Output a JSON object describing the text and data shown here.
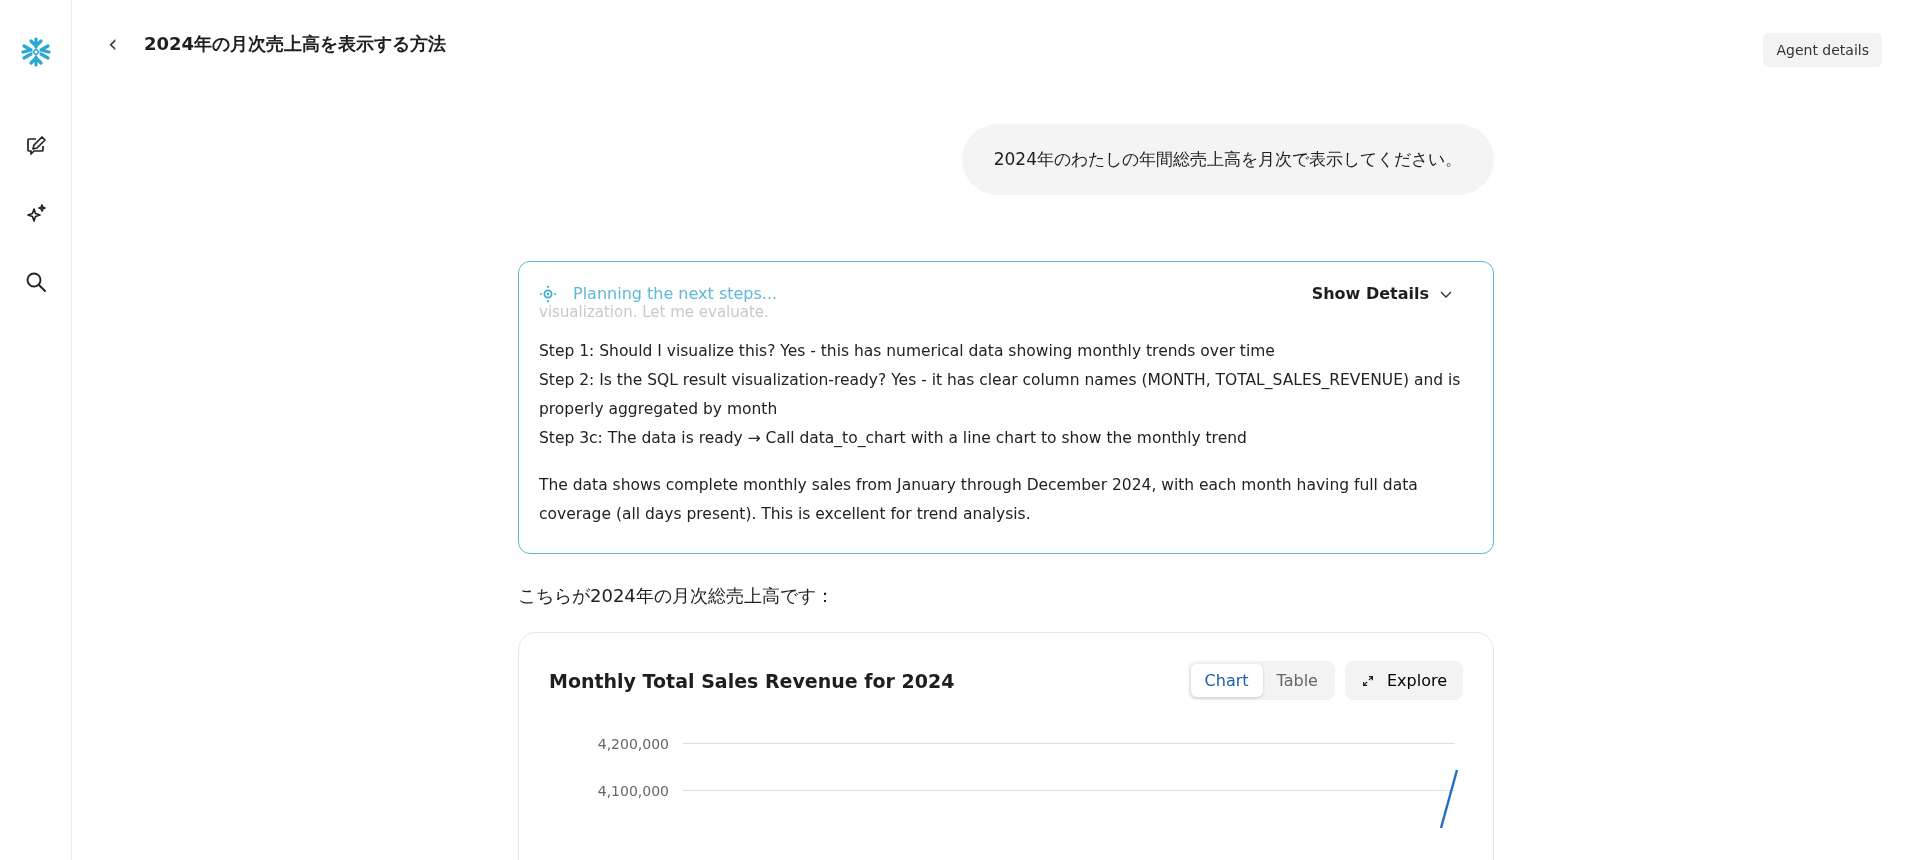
{
  "header": {
    "back": "‹",
    "title": "2024年の月次売上高を表示する方法",
    "agent_button": "Agent details"
  },
  "sidebar": {
    "items": [
      {
        "kind": "compose"
      },
      {
        "kind": "sparkle"
      },
      {
        "kind": "search"
      }
    ]
  },
  "user_message": "2024年のわたしの年間総売上高を月次で表示してください。",
  "planning": {
    "status": "Planning the next steps...",
    "toggle": "Show Details",
    "expanded": false,
    "faded_line": "visualization. Let me evaluate.",
    "paragraphs": [
      [
        "Step 1: Should I visualize this? Yes - this has numerical data showing monthly trends over time",
        "Step 2: Is the SQL result visualization-ready? Yes - it has clear column names (MONTH, TOTAL_SALES_REVENUE) and is properly aggregated by month",
        "Step 3c: The data is ready → Call data_to_chart with a line chart to show the monthly trend"
      ],
      [
        "The data shows complete monthly sales from January through December 2024, with each month having full data coverage (all days present). This is excellent for trend analysis."
      ]
    ]
  },
  "answer": "こちらが2024年の月次総売上高です：",
  "chart_card": {
    "title": "Monthly Total Sales Revenue for 2024",
    "views": [
      {
        "label": "Chart",
        "selected": true
      },
      {
        "label": "Table",
        "selected": false
      }
    ],
    "explore": "Explore",
    "y_ticks": [
      "4,200,000",
      "4,100,000"
    ]
  }
}
